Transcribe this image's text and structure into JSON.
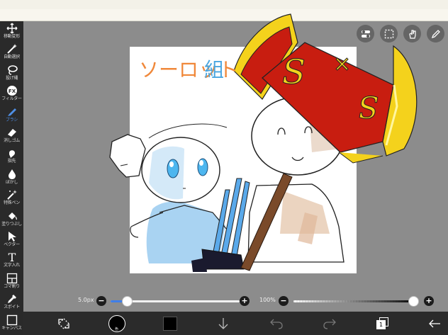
{
  "toolbar": {
    "items": [
      {
        "label": "移動変形",
        "icon": "move-transform-icon"
      },
      {
        "label": "自動選択",
        "icon": "magic-wand-icon"
      },
      {
        "label": "投げ縄",
        "icon": "lasso-icon"
      },
      {
        "label": "フィルター",
        "icon": "fx-filter-icon"
      },
      {
        "label": "ブラシ",
        "icon": "brush-icon",
        "active": true
      },
      {
        "label": "消しゴム",
        "icon": "eraser-icon"
      },
      {
        "label": "指先",
        "icon": "finger-smudge-icon"
      },
      {
        "label": "ぼかし",
        "icon": "blur-drop-icon"
      },
      {
        "label": "特殊ペン",
        "icon": "special-pen-icon"
      },
      {
        "label": "塗りつぶし",
        "icon": "bucket-fill-icon"
      },
      {
        "label": "ベクター",
        "icon": "vector-cursor-icon"
      },
      {
        "label": "文字入れ",
        "icon": "text-icon",
        "glyph": "T"
      },
      {
        "label": "コマ割り",
        "icon": "panel-frame-icon"
      },
      {
        "label": "スポイト",
        "icon": "eyedropper-icon"
      },
      {
        "label": "キャンバス",
        "icon": "canvas-icon"
      }
    ]
  },
  "canvas_text": {
    "title_part1": "ソーロット",
    "title_part2": "組",
    "axe_letter_1": "S",
    "axe_letter_2": "S",
    "axe_cross": "×"
  },
  "sliders": {
    "brush_size": {
      "label": "5.0px",
      "value_fraction": 0.08
    },
    "opacity": {
      "label": "100%",
      "value_fraction": 1.0
    },
    "minus": "−",
    "plus": "+"
  },
  "bottom": {
    "color_label": "色",
    "layer_count": "1"
  },
  "colors": {
    "accent": "#3f7ee8",
    "title_orange": "#f0883a",
    "title_blue": "#4aa6e0",
    "axe_red": "#c81d10",
    "axe_yellow": "#f4d21c"
  }
}
